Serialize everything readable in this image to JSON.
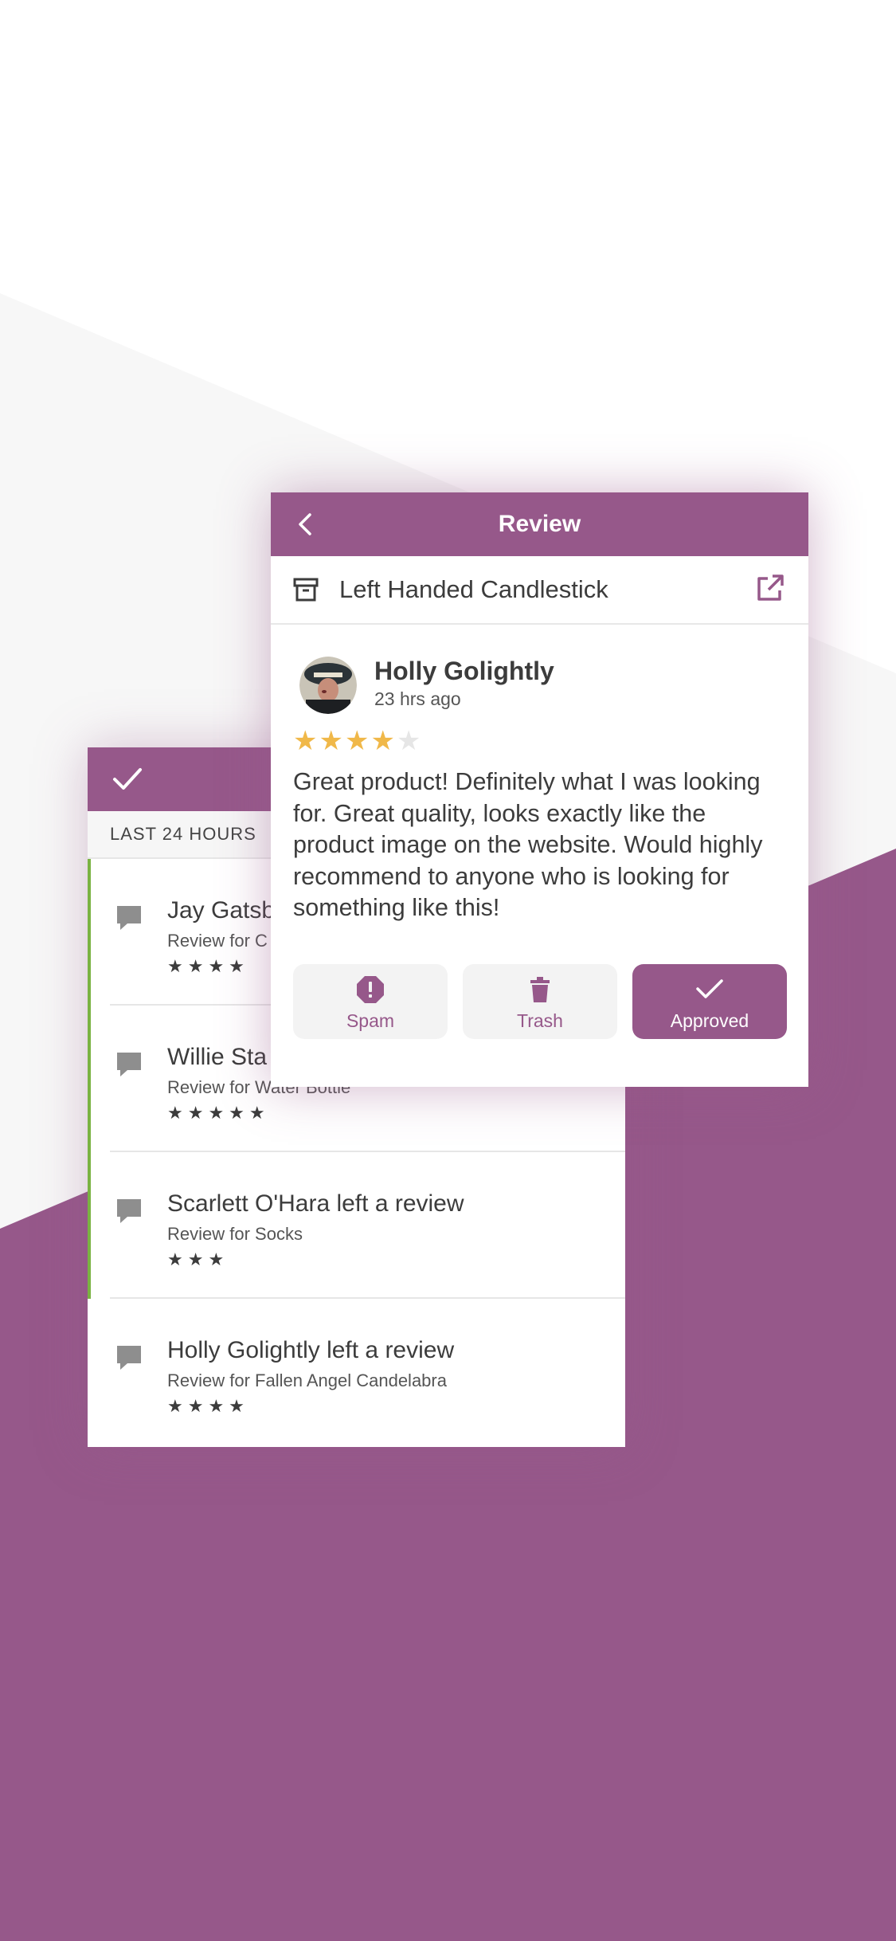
{
  "colors": {
    "brand_purple": "#96588a",
    "unread_green": "#7ab342",
    "star_gold": "#f0b849",
    "star_empty": "#e6e6e6"
  },
  "notifications": {
    "header_icon": "checkmark-icon",
    "section_label": "LAST 24 HOURS",
    "items": [
      {
        "title": "Jay Gatsb",
        "subtitle": "Review for C",
        "stars": "★★★★",
        "unread": true
      },
      {
        "title": "Willie Sta",
        "subtitle": "Review for Water Bottle",
        "stars": "★★★★★",
        "unread": true
      },
      {
        "title": "Scarlett O'Hara left a review",
        "subtitle": "Review for Socks",
        "stars": "★★★",
        "unread": true
      },
      {
        "title": "Holly Golightly left a review",
        "subtitle": "Review for Fallen Angel Candelabra",
        "stars": "★★★★",
        "unread": false
      }
    ]
  },
  "review": {
    "header_title": "Review",
    "product_name": "Left Handed Candlestick",
    "reviewer_name": "Holly Golightly",
    "time_ago": "23 hrs ago",
    "rating": 4,
    "rating_max": 5,
    "rating_filled": "★★★★",
    "rating_empty": "★",
    "text": "Great product! Definitely what I was looking for. Great quality, looks exactly like the product image on the website. Would highly recommend to anyone who is looking for something like this!",
    "actions": {
      "spam": "Spam",
      "trash": "Trash",
      "approved": "Approved"
    }
  }
}
